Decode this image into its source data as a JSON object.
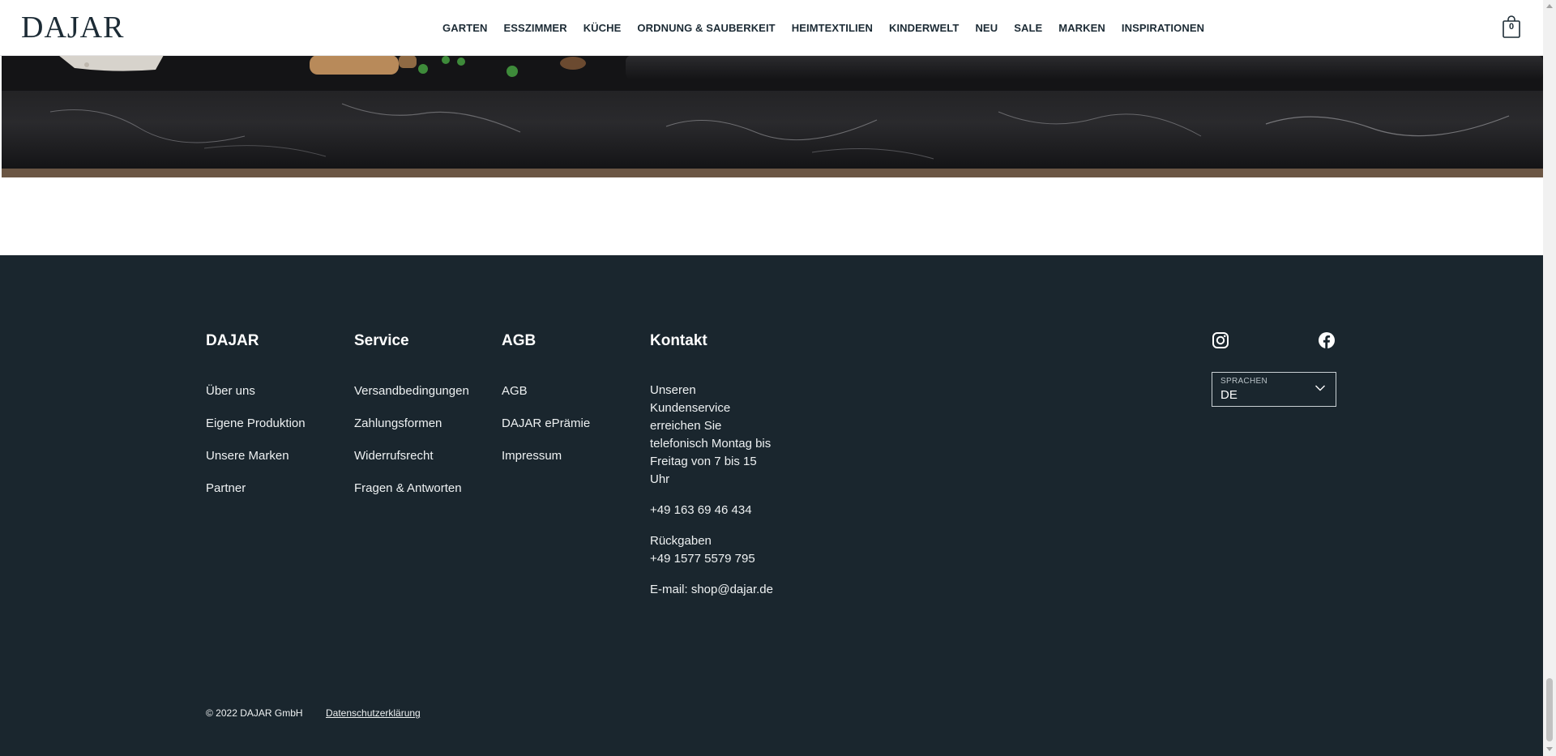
{
  "header": {
    "logo": "DAJAR",
    "nav": [
      "GARTEN",
      "ESSZIMMER",
      "KÜCHE",
      "ORDNUNG & SAUBERKEIT",
      "HEIMTEXTILIEN",
      "KINDERWELT",
      "NEU",
      "SALE",
      "MARKEN",
      "INSPIRATIONEN"
    ],
    "cart_count": "0",
    "cart_icon": "shopping-bag-icon"
  },
  "footer": {
    "columns": [
      {
        "title": "DAJAR",
        "links": [
          "Über uns",
          "Eigene Produktion",
          "Unsere Marken",
          "Partner"
        ]
      },
      {
        "title": "Service",
        "links": [
          "Versandbedingungen",
          "Zahlungsformen",
          "Widerrufsrecht",
          "Fragen & Antworten"
        ]
      },
      {
        "title": "AGB",
        "links": [
          "AGB",
          "DAJAR ePrämie",
          "Impressum"
        ]
      }
    ],
    "contact": {
      "title": "Kontakt",
      "hours": "Unseren Kundenservice erreichen Sie telefonisch Montag bis Freitag von 7 bis 15 Uhr",
      "phone": "+49 163 69 46 434",
      "returns_label": "Rückgaben",
      "returns_phone": "+49 1577 5579 795",
      "email": "E-mail: shop@dajar.de"
    },
    "social": [
      "instagram-icon",
      "facebook-icon"
    ],
    "language": {
      "label": "SPRACHEN",
      "value": "DE"
    },
    "copyright": "© 2022 DAJAR GmbH",
    "privacy": "Datenschutzerklärung"
  },
  "colors": {
    "footer_bg": "#1a262e",
    "header_text": "#1c2b35"
  }
}
